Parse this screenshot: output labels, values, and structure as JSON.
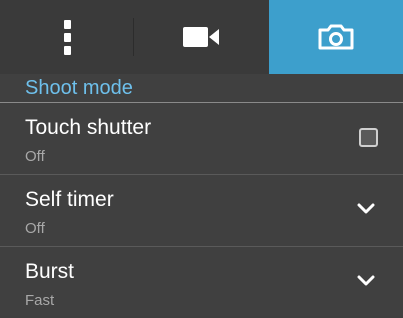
{
  "tabs": [
    {
      "name": "more-options",
      "icon": "more-vert-icon",
      "active": false
    },
    {
      "name": "video",
      "icon": "video-camera-icon",
      "active": false
    },
    {
      "name": "photo",
      "icon": "camera-icon",
      "active": true
    }
  ],
  "section": {
    "title": "Shoot mode"
  },
  "settings": [
    {
      "title": "Touch shutter",
      "value": "Off",
      "control": "checkbox",
      "checked": false
    },
    {
      "title": "Self timer",
      "value": "Off",
      "control": "dropdown"
    },
    {
      "title": "Burst",
      "value": "Fast",
      "control": "dropdown"
    }
  ],
  "colors": {
    "accent": "#3d9fcc",
    "header_text": "#6ec0ec",
    "background": "#404040"
  }
}
